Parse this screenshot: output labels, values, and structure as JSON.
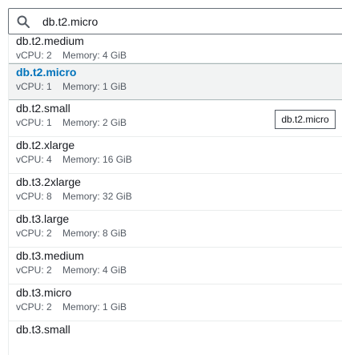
{
  "search": {
    "icon": "search-icon",
    "value": "db.t2.micro"
  },
  "options": [
    {
      "name": "db.t2.medium",
      "vcpu": "vCPU: 2",
      "memory": "Memory: 4 GiB"
    },
    {
      "name": "db.t2.micro",
      "vcpu": "vCPU: 1",
      "memory": "Memory: 1 GiB",
      "selected": true
    },
    {
      "name": "db.t2.small",
      "vcpu": "vCPU: 1",
      "memory": "Memory: 2 GiB"
    },
    {
      "name": "db.t2.xlarge",
      "vcpu": "vCPU: 4",
      "memory": "Memory: 16 GiB"
    },
    {
      "name": "db.t3.2xlarge",
      "vcpu": "vCPU: 8",
      "memory": "Memory: 32 GiB"
    },
    {
      "name": "db.t3.large",
      "vcpu": "vCPU: 2",
      "memory": "Memory: 8 GiB"
    },
    {
      "name": "db.t3.medium",
      "vcpu": "vCPU: 2",
      "memory": "Memory: 4 GiB"
    },
    {
      "name": "db.t3.micro",
      "vcpu": "vCPU: 2",
      "memory": "Memory: 1 GiB"
    },
    {
      "name": "db.t3.small",
      "vcpu": "",
      "memory": ""
    }
  ],
  "tooltip": {
    "text": "db.t2.micro"
  },
  "colors": {
    "selected_text": "#0073bb",
    "selected_bg": "#f2f3f3"
  }
}
